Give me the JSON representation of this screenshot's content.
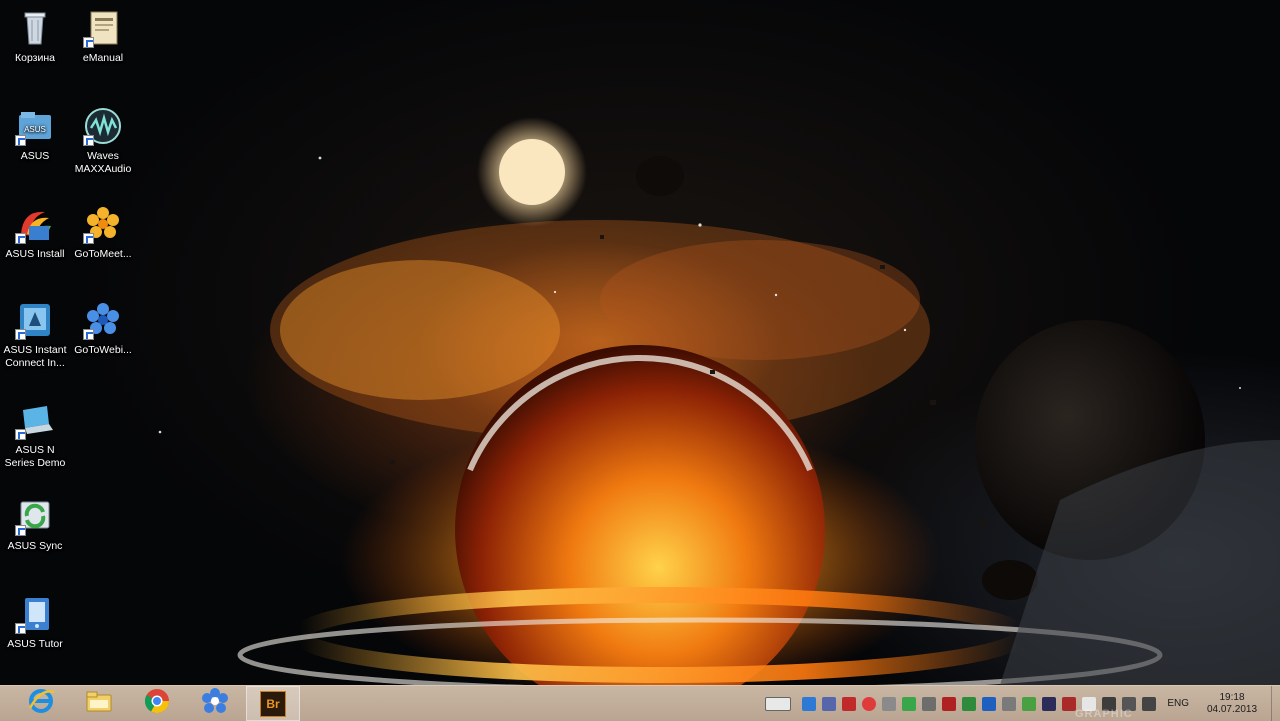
{
  "desktop": {
    "icons": [
      {
        "label": "Корзина",
        "icon": "recycle-bin-icon"
      },
      {
        "label": "eManual",
        "icon": "emanual-icon"
      },
      {
        "label": "ASUS",
        "icon": "asus-folder-icon"
      },
      {
        "label": "Waves MAXXAudio",
        "icon": "waves-maxxaudio-icon"
      },
      {
        "label": "ASUS Install",
        "icon": "asus-install-icon"
      },
      {
        "label": "GoToMeet...",
        "icon": "gotomeeting-icon"
      },
      {
        "label": "ASUS Instant Connect In...",
        "icon": "asus-instant-connect-icon"
      },
      {
        "label": "GoToWebi...",
        "icon": "gotowebinar-icon"
      },
      {
        "label": "ASUS N Series Demo",
        "icon": "asus-n-series-demo-icon"
      },
      {
        "label": "ASUS Sync",
        "icon": "asus-sync-icon"
      },
      {
        "label": "ASUS Tutor",
        "icon": "asus-tutor-icon"
      }
    ]
  },
  "taskbar": {
    "pinned": [
      {
        "name": "internet-explorer",
        "icon": "internet-explorer-icon"
      },
      {
        "name": "file-explorer",
        "icon": "folder-icon"
      },
      {
        "name": "chrome",
        "icon": "chrome-icon"
      },
      {
        "name": "gotomeeting",
        "icon": "gotomeeting-icon"
      },
      {
        "name": "adobe-bridge",
        "icon": "adobe-bridge-icon",
        "text": "Br"
      }
    ],
    "tray": {
      "language": "ENG",
      "time": "19:18",
      "date": "04.07.2013"
    }
  },
  "watermark": "GRAPHIC"
}
